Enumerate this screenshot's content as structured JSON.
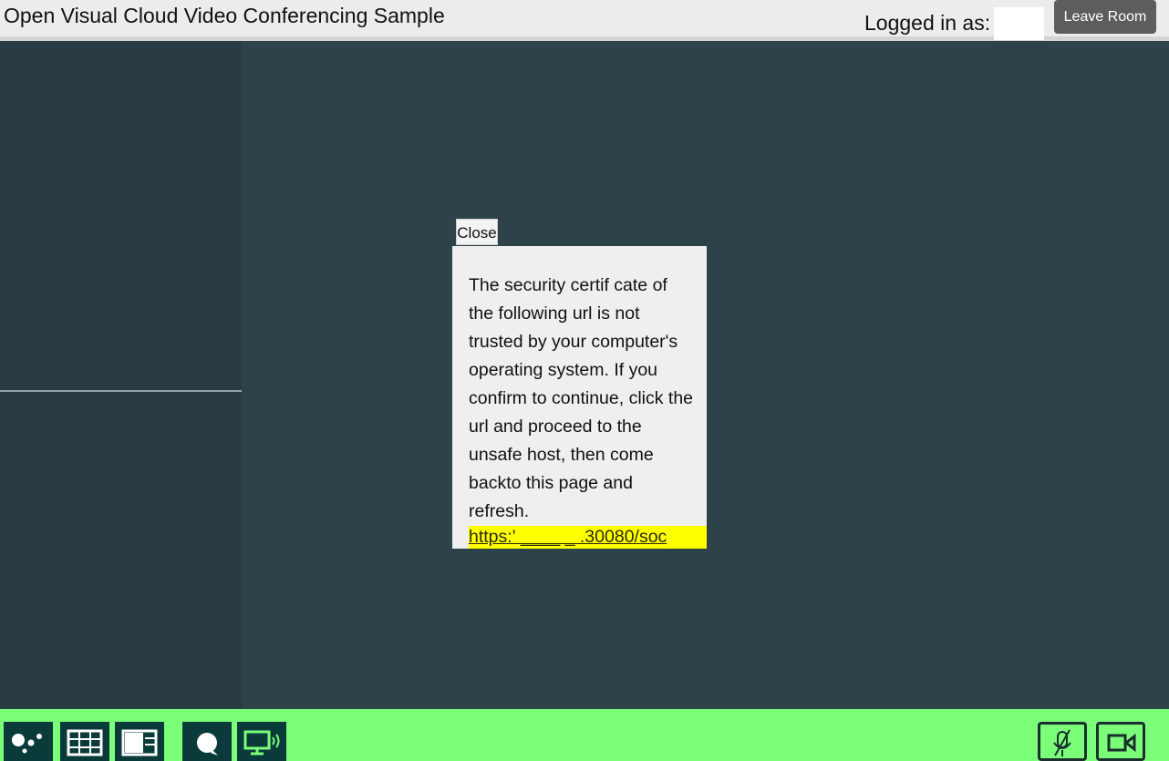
{
  "header": {
    "app_title": "Open Visual Cloud Video Conferencing Sample",
    "login_label": "Logged in as:",
    "leave_button": "Leave Room"
  },
  "dialog": {
    "close_label": "Close",
    "message": "The security certif cate of the following url is not trusted by your computer's operating system. If you confirm to continue, click the url and proceed to the unsafe host, then come backto this page and refresh.",
    "link_text": "https:' ____ _ .30080/soc"
  },
  "toolbar": {
    "left_buttons": [
      "participants-icon",
      "grid-layout-icon",
      "split-layout-icon",
      "chat-icon",
      "screen-share-icon"
    ],
    "right_buttons": [
      "mic-muted-icon",
      "camera-icon"
    ]
  },
  "colors": {
    "header_bg": "#ececec",
    "main_bg": "#2d4249",
    "side_panel_bg": "#293b42",
    "toolbar_bg": "#7bff79",
    "button_dark": "#0a3a3a",
    "leave_button_bg": "#5d5d5d",
    "link_highlight": "#ffff00"
  }
}
